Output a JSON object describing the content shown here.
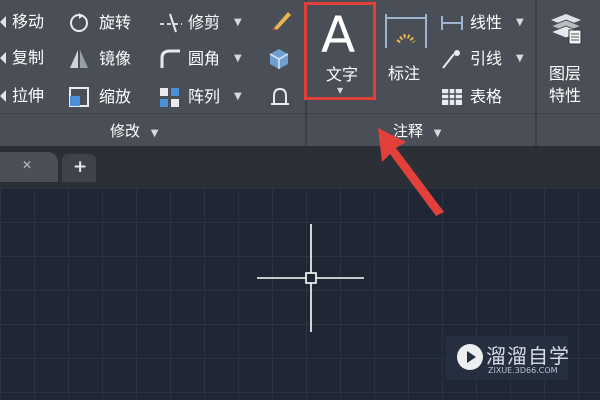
{
  "ribbon": {
    "modify": {
      "items": [
        {
          "label": "移动",
          "icon": "move-icon"
        },
        {
          "label": "旋转",
          "icon": "rotate-icon"
        },
        {
          "label": "修剪",
          "icon": "trim-icon",
          "dropdown": true
        },
        {
          "label": "复制",
          "icon": "copy-icon"
        },
        {
          "label": "镜像",
          "icon": "mirror-icon"
        },
        {
          "label": "圆角",
          "icon": "fillet-icon",
          "dropdown": true
        },
        {
          "label": "拉伸",
          "icon": "stretch-icon"
        },
        {
          "label": "缩放",
          "icon": "scale-icon"
        },
        {
          "label": "阵列",
          "icon": "array-icon",
          "dropdown": true
        }
      ],
      "title": "修改"
    },
    "annotation": {
      "text_button": "文字",
      "text_glyph": "A",
      "dim_button": "标注",
      "linear": "线性",
      "leader": "引线",
      "table": "表格",
      "title": "注释"
    },
    "layers": {
      "button": "图层",
      "button_line2": "特性"
    }
  },
  "tabs": {
    "close_glyph": "✕",
    "new_glyph": "+"
  },
  "watermark": {
    "text": "溜溜自学",
    "url": "ZIXUE.3D66.COM"
  },
  "colors": {
    "highlight": "#e2403a",
    "arrow": "#e2403a",
    "ribbon_bg": "#4a4f57",
    "canvas_bg": "#1f2734"
  }
}
